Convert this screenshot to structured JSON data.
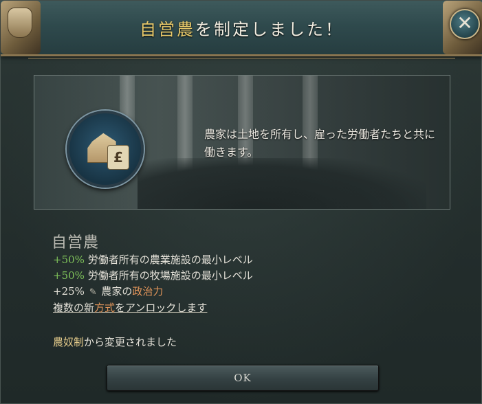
{
  "header": {
    "title_highlight": "自営農",
    "title_rest": "を制定しました！",
    "close_label": "✕"
  },
  "description": "農家は土地を所有し、雇った労働者たちと共に働きます。",
  "medallion": {
    "icon": "farm-house-price-tag-icon",
    "tag_symbol": "£"
  },
  "law": {
    "name": "自営農",
    "effects": [
      {
        "value": "+50%",
        "text": " 労働者所有の農業施設の最小レベル"
      },
      {
        "value": "+50%",
        "text": " 労働者所有の牧場施設の最小レベル"
      },
      {
        "value": "+25%",
        "icon": "quill-icon",
        "prefix": " 農家の",
        "highlight": "政治力"
      }
    ],
    "unlock": {
      "pre": "複数の新",
      "highlight": "方式",
      "post": "をアンロックします"
    },
    "changed_from": {
      "law": "農奴制",
      "text": "から変更されました"
    }
  },
  "ok_label": "OK",
  "colors": {
    "positive": "#7fc25a",
    "highlight": "#e2955a",
    "title_highlight": "#e8c96a"
  }
}
